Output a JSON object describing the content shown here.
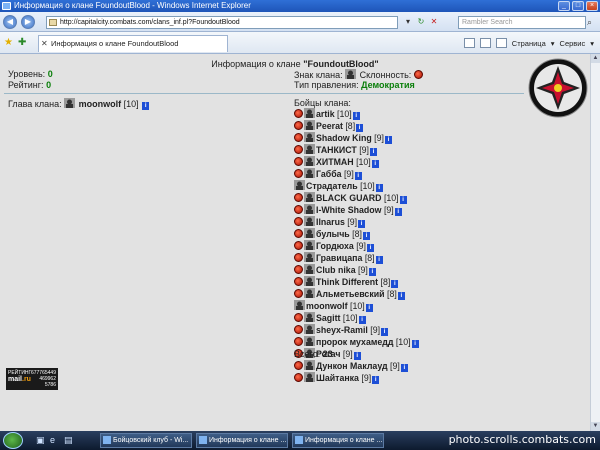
{
  "window": {
    "title": "Информация о клане FoundoutBlood - Windows Internet Explorer"
  },
  "address": {
    "url": "http://capitalcity.combats.com/clans_inf.pl?FoundoutBlood",
    "search_placeholder": "Rambler Search"
  },
  "tab": {
    "label": "Информация о клане FoundoutBlood"
  },
  "tools": {
    "page": "Страница",
    "service": "Сервис"
  },
  "clan": {
    "title_prefix": "Информация о клане",
    "name": "\"FoundoutBlood\"",
    "level_label": "Уровень:",
    "level": "0",
    "rating_label": "Рейтинг:",
    "rating": "0",
    "sign_label": "Знак клана:",
    "alignment_label": "Склонность:",
    "government_label": "Тип правления:",
    "government": "Демократия",
    "leader_label": "Глава клана:",
    "leader_name": "moonwolf",
    "leader_level": "[10]",
    "fighters_label": "Бойцы клана:",
    "total_label": "Всего:",
    "total": "23"
  },
  "fighters": [
    {
      "name": "artik",
      "level": "[10]",
      "align": true
    },
    {
      "name": "Peerat",
      "level": "[8]",
      "align": true
    },
    {
      "name": "Shadow King",
      "level": "[9]",
      "align": true
    },
    {
      "name": "ТАНКИСТ",
      "level": "[9]",
      "align": true
    },
    {
      "name": "ХИТМАН",
      "level": "[10]",
      "align": true
    },
    {
      "name": "Габба",
      "level": "[9]",
      "align": true
    },
    {
      "name": "Страдатель",
      "level": "[10]",
      "align": false
    },
    {
      "name": "BLACK GUARD",
      "level": "[10]",
      "align": true
    },
    {
      "name": "I-White Shadow",
      "level": "[9]",
      "align": true
    },
    {
      "name": "Ilnarus",
      "level": "[9]",
      "align": true
    },
    {
      "name": "булычь",
      "level": "[8]",
      "align": true
    },
    {
      "name": "Гордюха",
      "level": "[9]",
      "align": true
    },
    {
      "name": "Гравицапа",
      "level": "[8]",
      "align": true
    },
    {
      "name": "Club nika",
      "level": "[9]",
      "align": true
    },
    {
      "name": "Think Different",
      "level": "[8]",
      "align": true
    },
    {
      "name": "Альметьевский",
      "level": "[8]",
      "align": true
    },
    {
      "name": "moonwolf",
      "level": "[10]",
      "align": false
    },
    {
      "name": "Sagitt",
      "level": "[10]",
      "align": true
    },
    {
      "name": "sheyx-Ramil",
      "level": "[9]",
      "align": true
    },
    {
      "name": "пророк мухамедд",
      "level": "[10]",
      "align": true
    },
    {
      "name": "Рогач",
      "level": "[9]",
      "align": true
    },
    {
      "name": "Дункон Маклауд",
      "level": "[9]",
      "align": true
    },
    {
      "name": "Шайтанка",
      "level": "[9]",
      "align": true
    }
  ],
  "counter": {
    "label": "РЕЙТИНГ",
    "brand_a": "mail",
    "brand_b": ".ru",
    "n1": "677765449",
    "n2": "469962",
    "n3": "5786"
  },
  "taskbar": {
    "tasks": [
      "Бойцовский клуб - Wi...",
      "Информация о клане ...",
      "Информация о клане ..."
    ]
  },
  "watermark": "photo.scrolls.combats.com",
  "colors": {
    "accent_green": "#0a7f0a",
    "info_blue": "#1d4fd6",
    "align_red": "#a30e00"
  }
}
